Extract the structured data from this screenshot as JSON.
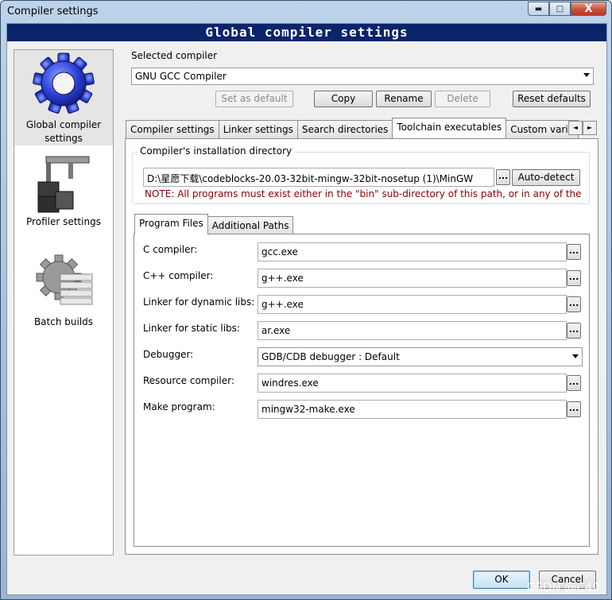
{
  "window": {
    "title": "Compiler settings",
    "minimize_glyph": "▬",
    "maximize_glyph": "□",
    "close_glyph": "X"
  },
  "banner": {
    "title": "Global compiler settings"
  },
  "sidebar": {
    "items": [
      {
        "label_line1": "Global compiler",
        "label_line2": "settings",
        "icon": "gear-icon",
        "selected": true
      },
      {
        "label": "Profiler settings",
        "icon": "caliper-icon"
      },
      {
        "label": "Batch builds",
        "icon": "gear-stack-icon"
      }
    ]
  },
  "compiler": {
    "selected_label": "Selected compiler",
    "selected_value": "GNU GCC Compiler",
    "buttons": {
      "set_default": "Set as default",
      "copy": "Copy",
      "rename": "Rename",
      "delete": "Delete",
      "reset_defaults": "Reset defaults"
    }
  },
  "tabs": [
    "Compiler settings",
    "Linker settings",
    "Search directories",
    "Toolchain executables",
    "Custom variab"
  ],
  "tab_scroll": {
    "left": "◄",
    "right": "►"
  },
  "install_dir": {
    "group_title": "Compiler's installation directory",
    "path": "D:\\星愿下载\\codeblocks-20.03-32bit-mingw-32bit-nosetup (1)\\MinGW",
    "browse": "...",
    "auto_detect": "Auto-detect",
    "note": "NOTE: All programs must exist either in the \"bin\" sub-directory of this path, or in any of the"
  },
  "subtabs": [
    "Program Files",
    "Additional Paths"
  ],
  "programs": [
    {
      "label": "C compiler:",
      "value": "gcc.exe",
      "browse": "..."
    },
    {
      "label": "C++ compiler:",
      "value": "g++.exe",
      "browse": "..."
    },
    {
      "label": "Linker for dynamic libs:",
      "value": "g++.exe",
      "browse": "..."
    },
    {
      "label": "Linker for static libs:",
      "value": "ar.exe",
      "browse": "..."
    },
    {
      "label": "Debugger:",
      "value": "GDB/CDB debugger : Default"
    },
    {
      "label": "Resource compiler:",
      "value": "windres.exe",
      "browse": "..."
    },
    {
      "label": "Make program:",
      "value": "mingw32-make.exe",
      "browse": "..."
    }
  ],
  "footer": {
    "ok": "OK",
    "cancel": "Cancel"
  },
  "watermark": "CSDN @C40"
}
